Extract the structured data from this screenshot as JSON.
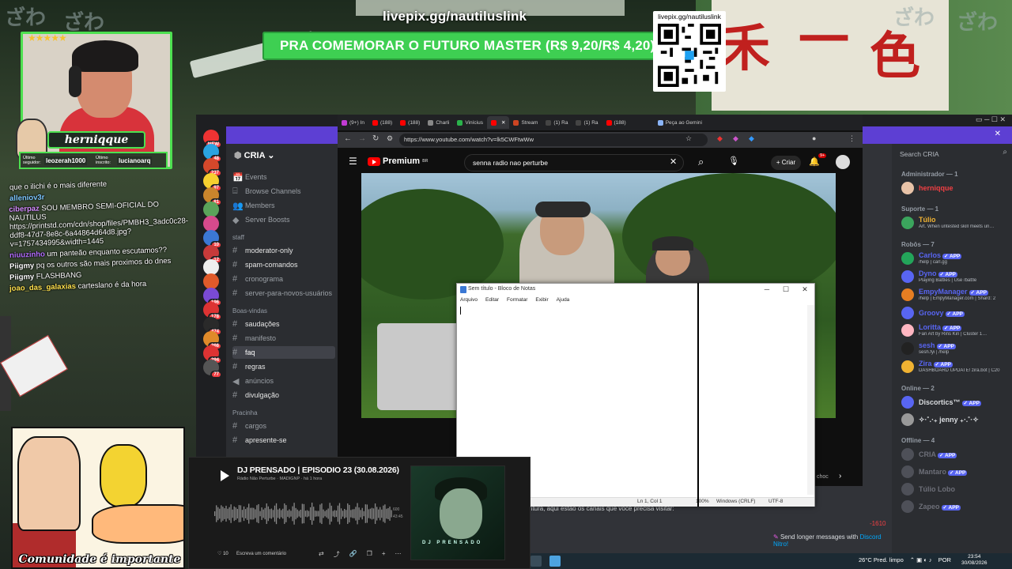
{
  "overlay": {
    "donation_url": "livepix.gg/nautiluslink",
    "banner_text": "PRA COMEMORAR O FUTURO MASTER (R$ 9,20/R$ 4,20)",
    "qr_title": "livepix.gg/nautiluslink",
    "streamer_name": "herniqque",
    "rating_stars": "★★★★★",
    "last_follower_label": "Último seguidor:",
    "last_follower": "leozerah1000",
    "last_sub_label": "Último inscrito:",
    "last_sub": "lucianoarq",
    "meme_caption": "Comunidade é importante"
  },
  "chat": [
    {
      "user": "",
      "text": "que o ilichi é o mais diferente",
      "color": "#ffffff"
    },
    {
      "user": "alleniov3r",
      "text": "",
      "color": "#7ec8ff"
    },
    {
      "user": "ciberpaz",
      "text": "SOU MEMBRO SEMI-OFICIAL DO NAUTILUS https://printstd.com/cdn/shop/files/PMBH3_3adc0c28-ddf8-47d7-8e8c-6a44864d64d8.jpg?v=1757434995&width=1445",
      "color": "#d58cff"
    },
    {
      "user": "niuuzinho",
      "text": "um panteão enquanto escutamos??",
      "color": "#b36cff"
    },
    {
      "user": "Piigmy",
      "text": "pq os outros são mais proximos do dnes",
      "color": "#ffffff"
    },
    {
      "user": "Piigmy",
      "text": "FLASHBANG",
      "color": "#ffffff"
    },
    {
      "user": "joao_das_galaxias",
      "text": "carteslano é da hora",
      "color": "#ffe14d"
    }
  ],
  "discord": {
    "server_name": "CRIA",
    "nav": [
      "Events",
      "Browse Channels",
      "Members",
      "Server Boosts"
    ],
    "cat_staff": "staff",
    "staff_channels": [
      "moderator-only",
      "spam-comandos",
      "cronograma",
      "server-para-novos-usuários"
    ],
    "cat_welcome": "Boas-vindas",
    "welcome_channels": [
      "saudações",
      "manifesto",
      "faq",
      "regras",
      "anúncios",
      "divulgação"
    ],
    "cat_square": "Pracinha",
    "square_channels": [
      "cargos",
      "apresente-se"
    ],
    "guild_badges": [
      "NEW",
      "48",
      "237",
      "97",
      "81",
      "",
      "",
      "10",
      "12",
      "",
      "",
      "196",
      "178",
      "474",
      "266",
      "294",
      "77"
    ],
    "search_placeholder": "Search CRIA",
    "member_groups": [
      {
        "label": "Administrador — 1",
        "members": [
          {
            "name": "herniqque",
            "status": "",
            "color": "#f23f43",
            "app": false
          }
        ]
      },
      {
        "label": "Suporte — 1",
        "members": [
          {
            "name": "Túlio",
            "status": "Art. When untested skill meets un…",
            "color": "#f0b232",
            "app": false
          }
        ]
      },
      {
        "label": "Robôs — 7",
        "members": [
          {
            "name": "Carlos",
            "status": "/help | carl.gg",
            "color": "#5865f2",
            "app": true
          },
          {
            "name": "Dyno",
            "status": "Playing Battles | Use /battle",
            "color": "#5865f2",
            "app": true
          },
          {
            "name": "EmpyManager",
            "status": "/help | EmpyManager.com | Shard: 2",
            "color": "#5865f2",
            "app": true
          },
          {
            "name": "Groovy",
            "status": "",
            "color": "#5865f2",
            "app": true
          },
          {
            "name": "Loritta",
            "status": "Fan Art by Rins Kin | Cluster 1…",
            "color": "#5865f2",
            "app": true
          },
          {
            "name": "sesh",
            "status": "sesh.fyi | /help",
            "color": "#5865f2",
            "app": true
          },
          {
            "name": "Zira",
            "status": "DASHBOARD UPDATE! zira.bot | C20",
            "color": "#5865f2",
            "app": true
          }
        ]
      },
      {
        "label": "Online — 2",
        "members": [
          {
            "name": "Discortics™",
            "status": "",
            "color": "#dbdee1",
            "app": true
          },
          {
            "name": "✧·˚.‧₊ jenny ₊‧.˚·✧",
            "status": "",
            "color": "#dbdee1",
            "app": false
          }
        ]
      },
      {
        "label": "Offline — 4",
        "members": [
          {
            "name": "CRIA",
            "status": "",
            "color": "#6d6f78",
            "app": true
          },
          {
            "name": "Mantaro",
            "status": "",
            "color": "#6d6f78",
            "app": true
          },
          {
            "name": "Túlio Lobo",
            "status": "",
            "color": "#6d6f78",
            "app": false
          },
          {
            "name": "Zapeo",
            "status": "",
            "color": "#6d6f78",
            "app": true
          }
        ]
      }
    ],
    "message_fragment": "ntura, aqui estão os canais que você precisa visitar:",
    "red_number": "-1610",
    "nitro_text": "Send longer messages with",
    "nitro_link": "Discord Nitro!"
  },
  "browser": {
    "tabs": [
      "(9+) In",
      "(188)",
      "(188)",
      "Charli",
      "Vinícius",
      "",
      "Stream",
      "(1) Ra",
      "(1) Ra",
      "(188)",
      "Peça ao Gemini"
    ],
    "url": "https://www.youtube.com/watch?v=lk5CWFtwWw",
    "yt_logo": "Premium",
    "yt_logo_sup": "BR",
    "search_query": "senna radio nao perturbe",
    "create_label": "Criar",
    "notif_count": "9+",
    "side_text": "choc"
  },
  "notepad": {
    "title": "Sem título - Bloco de Notas",
    "menu": [
      "Arquivo",
      "Editar",
      "Formatar",
      "Exibir",
      "Ajuda"
    ],
    "status_pos": "Ln 1, Col 1",
    "status_zoom": "100%",
    "status_eol": "Windows (CRLF)",
    "status_enc": "UTF-8"
  },
  "player": {
    "title": "DJ PRENSADO | EPISODIO 23 (30.08.2026)",
    "subtitle": "Rádio Não Perturbe · MADIGNP · há 1 hora",
    "comment_placeholder": "Escreva um comentário",
    "likes": "10",
    "time_a": "600",
    "time_b": "43:45",
    "cover_name": "DJ PRENSADO"
  },
  "taskbar": {
    "weather": "26°C  Pred. limpo",
    "lang": "POR",
    "time": "23:54",
    "date": "30/08/2026"
  },
  "colors": {
    "banner_green": "#3ecf52",
    "discord_bg": "#313338",
    "discord_accent": "#5d3fd3",
    "youtube_red": "#ff0000"
  }
}
